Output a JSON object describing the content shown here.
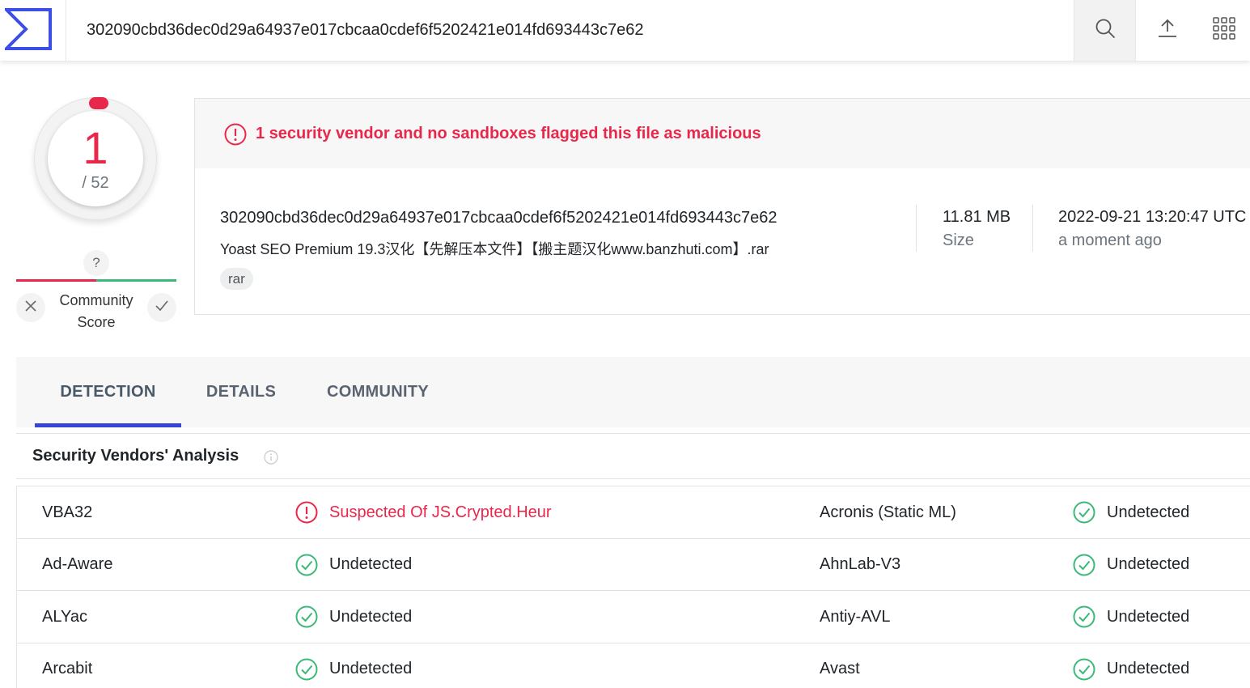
{
  "header": {
    "search_value": "302090cbd36dec0d29a64937e017cbcaa0cdef6f5202421e014fd693443c7e62",
    "icons": [
      "virustotal-logo",
      "search-icon",
      "upload-icon",
      "apps-grid-icon"
    ]
  },
  "score": {
    "detections": "1",
    "total": "/ 52",
    "community_question": "?",
    "community_label": "Community Score"
  },
  "summary": {
    "alert": "1 security vendor and no sandboxes flagged this file as malicious",
    "hash": "302090cbd36dec0d29a64937e017cbcaa0cdef6f5202421e014fd693443c7e62",
    "filename": "Yoast SEO Premium 19.3汉化【先解压本文件】【搬主题汉化www.banzhuti.com】.rar",
    "tag": "rar",
    "size_value": "11.81 MB",
    "size_label": "Size",
    "date_value": "2022-09-21 13:20:47 UTC",
    "date_label": "a moment ago"
  },
  "tabs": [
    "DETECTION",
    "DETAILS",
    "COMMUNITY"
  ],
  "analysis": {
    "title": "Security Vendors' Analysis",
    "rows": [
      {
        "left_vendor": "VBA32",
        "left_result": "Suspected Of JS.Crypted.Heur",
        "right_vendor": "Acronis (Static ML)",
        "right_result": "Undetected"
      },
      {
        "left_vendor": "Ad-Aware",
        "left_result": "Undetected",
        "right_vendor": "AhnLab-V3",
        "right_result": "Undetected"
      },
      {
        "left_vendor": "ALYac",
        "left_result": "Undetected",
        "right_vendor": "Antiy-AVL",
        "right_result": "Undetected"
      },
      {
        "left_vendor": "Arcabit",
        "left_result": "Undetected",
        "right_vendor": "Avast",
        "right_result": "Undetected"
      }
    ]
  },
  "colors": {
    "malicious": "#e8274b",
    "clean": "#3cb878",
    "accent": "#3545d9"
  }
}
